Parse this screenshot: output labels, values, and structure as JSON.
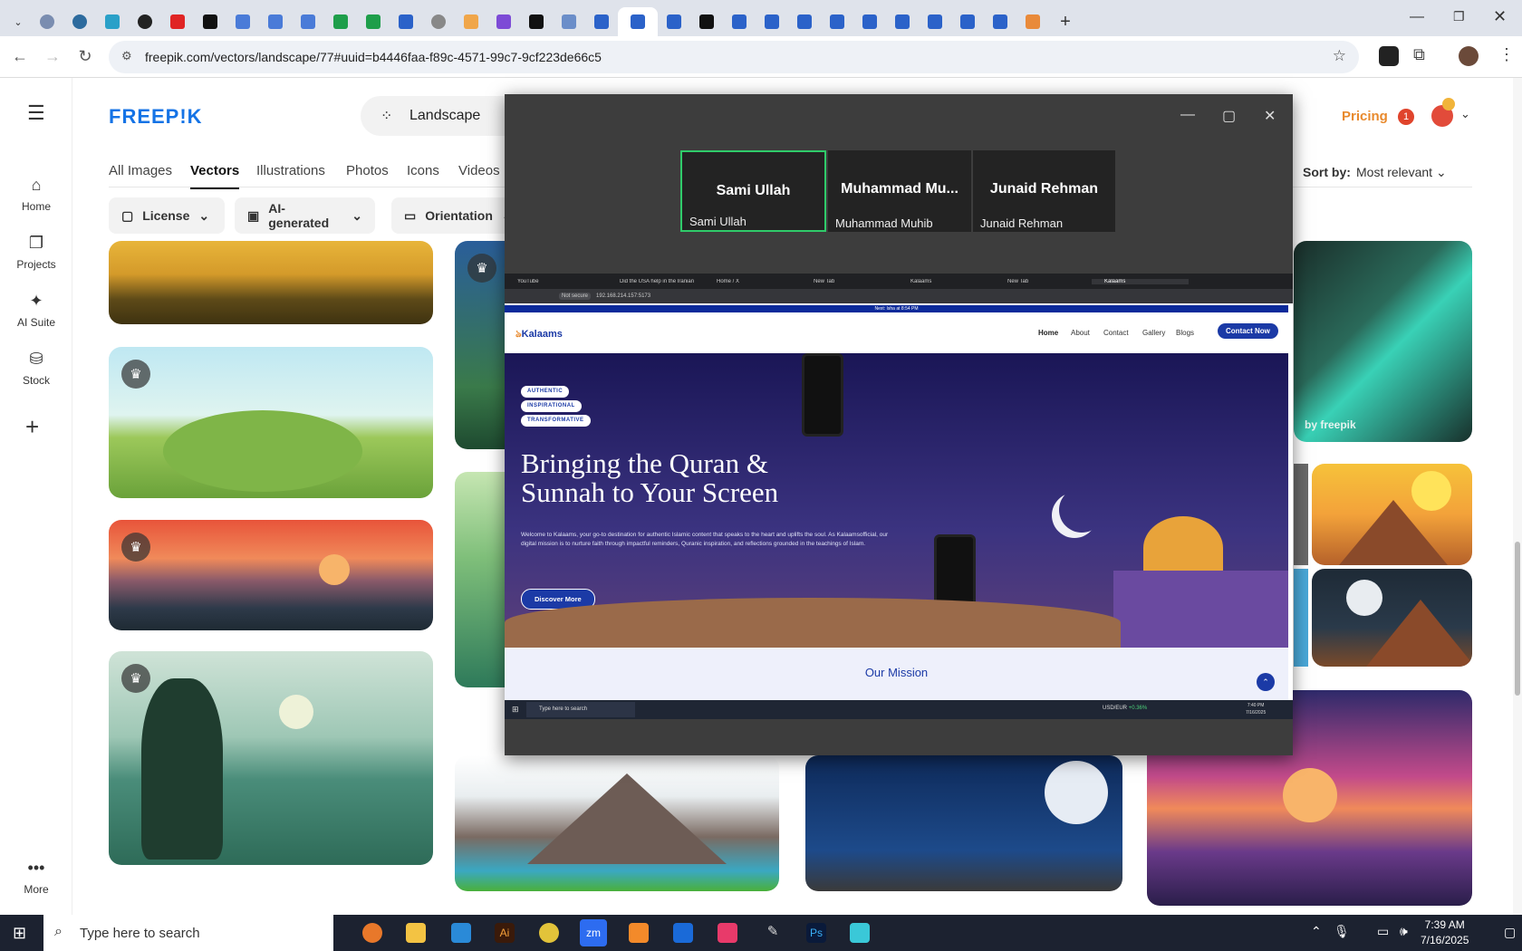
{
  "browser": {
    "url": "freepik.com/vectors/landscape/77#uuid=b4446faa-f89c-4571-99c7-9cf223de66c5"
  },
  "freepik": {
    "logo": "FREEP!K",
    "search_value": "Landscape",
    "pricing": "Pricing",
    "notif_count": "1",
    "leftnav": [
      {
        "label": "Home"
      },
      {
        "label": "Projects"
      },
      {
        "label": "AI Suite"
      },
      {
        "label": "Stock"
      },
      {
        "label": "More"
      }
    ],
    "tabs": [
      "All Images",
      "Vectors",
      "Illustrations",
      "Photos",
      "Icons",
      "Videos"
    ],
    "filters": [
      "License",
      "AI-generated",
      "Orientation"
    ],
    "sort_label": "Sort by:",
    "sort_value": "Most relevant",
    "watermark": "by freepik"
  },
  "zoom": {
    "participants": [
      {
        "name": "Sami Ullah",
        "label": "Sami Ullah"
      },
      {
        "name": "Muhammad  Mu...",
        "label": "Muhammad Muhib"
      },
      {
        "name": "Junaid Rehman",
        "label": "Junaid Rehman"
      }
    ],
    "shared": {
      "tabs": [
        "YouTube",
        "Did the USA help in the Iranian",
        "Home / X",
        "New Tab",
        "Kalaams",
        "New Tab",
        "Kalaams"
      ],
      "addr_warning": "Not secure",
      "addr_url": "192.168.214.157:5173",
      "banner": "Next: Isha at 8:54 PM",
      "logo": "Kalaams",
      "nav": [
        "Home",
        "About",
        "Contact",
        "Gallery",
        "Blogs"
      ],
      "cta": "Contact Now",
      "pills": [
        "AUTHENTIC",
        "INSPIRATIONAL",
        "TRANSFORMATIVE"
      ],
      "headline1": "Bringing the Quran &",
      "headline2": "Sunnah to Your Screen",
      "para": "Welcome to Kalaams, your go-to destination for authentic Islamic content that speaks to the heart and uplifts the soul. As Kalaamsofficial, our digital mission is to nurture faith through impactful reminders, Quranic inspiration, and reflections grounded in the teachings of Islam.",
      "discover": "Discover More",
      "mission": "Our Mission",
      "task_search": "Type here to search",
      "task_ticker": "USD/EUR",
      "task_change": "+0.36%",
      "task_time": "7:40 PM",
      "task_date": "7/16/2025"
    }
  },
  "taskbar": {
    "search": "Type here to search",
    "time": "7:39 AM",
    "date": "7/16/2025"
  }
}
